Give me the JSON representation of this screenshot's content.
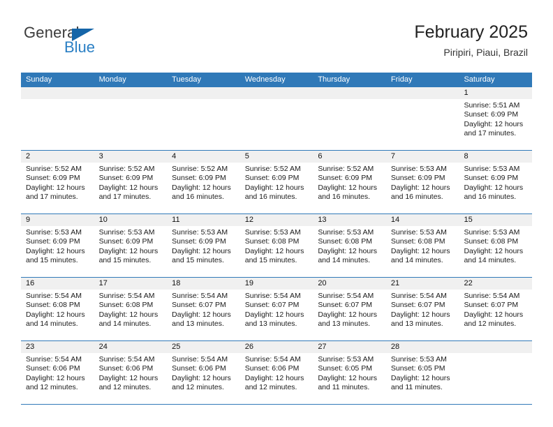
{
  "brand": {
    "name_top": "General",
    "name_bottom": "Blue",
    "triangle_color": "#1565a8",
    "blue_color": "#2a7fc4"
  },
  "header": {
    "title": "February 2025",
    "subtitle": "Piripiri, Piaui, Brazil"
  },
  "theme": {
    "header_blue": "#3079b8",
    "daynum_band": "#f0f0f0"
  },
  "weekdays": [
    "Sunday",
    "Monday",
    "Tuesday",
    "Wednesday",
    "Thursday",
    "Friday",
    "Saturday"
  ],
  "weeks": [
    [
      {
        "day": "",
        "sunrise": "",
        "sunset": "",
        "daylight_line1": "",
        "daylight_line2": "",
        "empty": true
      },
      {
        "day": "",
        "sunrise": "",
        "sunset": "",
        "daylight_line1": "",
        "daylight_line2": "",
        "empty": true
      },
      {
        "day": "",
        "sunrise": "",
        "sunset": "",
        "daylight_line1": "",
        "daylight_line2": "",
        "empty": true
      },
      {
        "day": "",
        "sunrise": "",
        "sunset": "",
        "daylight_line1": "",
        "daylight_line2": "",
        "empty": true
      },
      {
        "day": "",
        "sunrise": "",
        "sunset": "",
        "daylight_line1": "",
        "daylight_line2": "",
        "empty": true
      },
      {
        "day": "",
        "sunrise": "",
        "sunset": "",
        "daylight_line1": "",
        "daylight_line2": "",
        "empty": true
      },
      {
        "day": "1",
        "sunrise": "Sunrise: 5:51 AM",
        "sunset": "Sunset: 6:09 PM",
        "daylight_line1": "Daylight: 12 hours",
        "daylight_line2": "and 17 minutes."
      }
    ],
    [
      {
        "day": "2",
        "sunrise": "Sunrise: 5:52 AM",
        "sunset": "Sunset: 6:09 PM",
        "daylight_line1": "Daylight: 12 hours",
        "daylight_line2": "and 17 minutes."
      },
      {
        "day": "3",
        "sunrise": "Sunrise: 5:52 AM",
        "sunset": "Sunset: 6:09 PM",
        "daylight_line1": "Daylight: 12 hours",
        "daylight_line2": "and 17 minutes."
      },
      {
        "day": "4",
        "sunrise": "Sunrise: 5:52 AM",
        "sunset": "Sunset: 6:09 PM",
        "daylight_line1": "Daylight: 12 hours",
        "daylight_line2": "and 16 minutes."
      },
      {
        "day": "5",
        "sunrise": "Sunrise: 5:52 AM",
        "sunset": "Sunset: 6:09 PM",
        "daylight_line1": "Daylight: 12 hours",
        "daylight_line2": "and 16 minutes."
      },
      {
        "day": "6",
        "sunrise": "Sunrise: 5:52 AM",
        "sunset": "Sunset: 6:09 PM",
        "daylight_line1": "Daylight: 12 hours",
        "daylight_line2": "and 16 minutes."
      },
      {
        "day": "7",
        "sunrise": "Sunrise: 5:53 AM",
        "sunset": "Sunset: 6:09 PM",
        "daylight_line1": "Daylight: 12 hours",
        "daylight_line2": "and 16 minutes."
      },
      {
        "day": "8",
        "sunrise": "Sunrise: 5:53 AM",
        "sunset": "Sunset: 6:09 PM",
        "daylight_line1": "Daylight: 12 hours",
        "daylight_line2": "and 16 minutes."
      }
    ],
    [
      {
        "day": "9",
        "sunrise": "Sunrise: 5:53 AM",
        "sunset": "Sunset: 6:09 PM",
        "daylight_line1": "Daylight: 12 hours",
        "daylight_line2": "and 15 minutes."
      },
      {
        "day": "10",
        "sunrise": "Sunrise: 5:53 AM",
        "sunset": "Sunset: 6:09 PM",
        "daylight_line1": "Daylight: 12 hours",
        "daylight_line2": "and 15 minutes."
      },
      {
        "day": "11",
        "sunrise": "Sunrise: 5:53 AM",
        "sunset": "Sunset: 6:09 PM",
        "daylight_line1": "Daylight: 12 hours",
        "daylight_line2": "and 15 minutes."
      },
      {
        "day": "12",
        "sunrise": "Sunrise: 5:53 AM",
        "sunset": "Sunset: 6:08 PM",
        "daylight_line1": "Daylight: 12 hours",
        "daylight_line2": "and 15 minutes."
      },
      {
        "day": "13",
        "sunrise": "Sunrise: 5:53 AM",
        "sunset": "Sunset: 6:08 PM",
        "daylight_line1": "Daylight: 12 hours",
        "daylight_line2": "and 14 minutes."
      },
      {
        "day": "14",
        "sunrise": "Sunrise: 5:53 AM",
        "sunset": "Sunset: 6:08 PM",
        "daylight_line1": "Daylight: 12 hours",
        "daylight_line2": "and 14 minutes."
      },
      {
        "day": "15",
        "sunrise": "Sunrise: 5:53 AM",
        "sunset": "Sunset: 6:08 PM",
        "daylight_line1": "Daylight: 12 hours",
        "daylight_line2": "and 14 minutes."
      }
    ],
    [
      {
        "day": "16",
        "sunrise": "Sunrise: 5:54 AM",
        "sunset": "Sunset: 6:08 PM",
        "daylight_line1": "Daylight: 12 hours",
        "daylight_line2": "and 14 minutes."
      },
      {
        "day": "17",
        "sunrise": "Sunrise: 5:54 AM",
        "sunset": "Sunset: 6:08 PM",
        "daylight_line1": "Daylight: 12 hours",
        "daylight_line2": "and 14 minutes."
      },
      {
        "day": "18",
        "sunrise": "Sunrise: 5:54 AM",
        "sunset": "Sunset: 6:07 PM",
        "daylight_line1": "Daylight: 12 hours",
        "daylight_line2": "and 13 minutes."
      },
      {
        "day": "19",
        "sunrise": "Sunrise: 5:54 AM",
        "sunset": "Sunset: 6:07 PM",
        "daylight_line1": "Daylight: 12 hours",
        "daylight_line2": "and 13 minutes."
      },
      {
        "day": "20",
        "sunrise": "Sunrise: 5:54 AM",
        "sunset": "Sunset: 6:07 PM",
        "daylight_line1": "Daylight: 12 hours",
        "daylight_line2": "and 13 minutes."
      },
      {
        "day": "21",
        "sunrise": "Sunrise: 5:54 AM",
        "sunset": "Sunset: 6:07 PM",
        "daylight_line1": "Daylight: 12 hours",
        "daylight_line2": "and 13 minutes."
      },
      {
        "day": "22",
        "sunrise": "Sunrise: 5:54 AM",
        "sunset": "Sunset: 6:07 PM",
        "daylight_line1": "Daylight: 12 hours",
        "daylight_line2": "and 12 minutes."
      }
    ],
    [
      {
        "day": "23",
        "sunrise": "Sunrise: 5:54 AM",
        "sunset": "Sunset: 6:06 PM",
        "daylight_line1": "Daylight: 12 hours",
        "daylight_line2": "and 12 minutes."
      },
      {
        "day": "24",
        "sunrise": "Sunrise: 5:54 AM",
        "sunset": "Sunset: 6:06 PM",
        "daylight_line1": "Daylight: 12 hours",
        "daylight_line2": "and 12 minutes."
      },
      {
        "day": "25",
        "sunrise": "Sunrise: 5:54 AM",
        "sunset": "Sunset: 6:06 PM",
        "daylight_line1": "Daylight: 12 hours",
        "daylight_line2": "and 12 minutes."
      },
      {
        "day": "26",
        "sunrise": "Sunrise: 5:54 AM",
        "sunset": "Sunset: 6:06 PM",
        "daylight_line1": "Daylight: 12 hours",
        "daylight_line2": "and 12 minutes."
      },
      {
        "day": "27",
        "sunrise": "Sunrise: 5:53 AM",
        "sunset": "Sunset: 6:05 PM",
        "daylight_line1": "Daylight: 12 hours",
        "daylight_line2": "and 11 minutes."
      },
      {
        "day": "28",
        "sunrise": "Sunrise: 5:53 AM",
        "sunset": "Sunset: 6:05 PM",
        "daylight_line1": "Daylight: 12 hours",
        "daylight_line2": "and 11 minutes."
      },
      {
        "day": "",
        "sunrise": "",
        "sunset": "",
        "daylight_line1": "",
        "daylight_line2": "",
        "empty": true
      }
    ]
  ]
}
